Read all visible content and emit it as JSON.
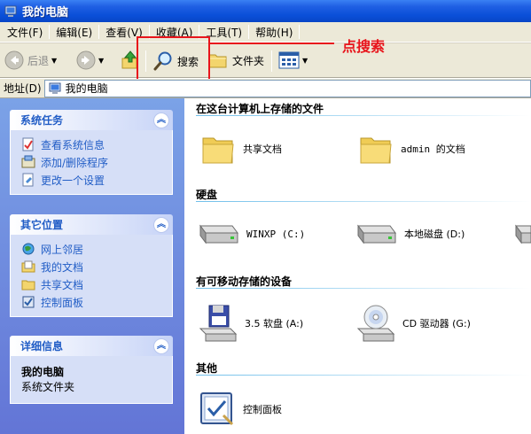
{
  "window": {
    "title": "我的电脑"
  },
  "menu": [
    "文件(F)",
    "编辑(E)",
    "查看(V)",
    "收藏(A)",
    "工具(T)",
    "帮助(H)"
  ],
  "toolbar": {
    "back": "后退",
    "search": "搜索",
    "folders": "文件夹"
  },
  "annotation": {
    "text": "点搜索"
  },
  "address": {
    "label": "地址(D)",
    "value": "我的电脑"
  },
  "panels": {
    "system_tasks": {
      "title": "系统任务",
      "items": [
        "查看系统信息",
        "添加/删除程序",
        "更改一个设置"
      ]
    },
    "other_places": {
      "title": "其它位置",
      "items": [
        "网上邻居",
        "我的文档",
        "共享文档",
        "控制面板"
      ]
    },
    "details": {
      "title": "详细信息",
      "name": "我的电脑",
      "type": "系统文件夹"
    }
  },
  "groups": {
    "stored_files": {
      "title": "在这台计算机上存储的文件",
      "items": [
        "共享文档",
        "admin 的文档"
      ]
    },
    "hard_disks": {
      "title": "硬盘",
      "items": [
        "WINXP (C:)",
        "本地磁盘 (D:)"
      ]
    },
    "removable": {
      "title": "有可移动存储的设备",
      "items": [
        "3.5 软盘 (A:)",
        "CD 驱动器 (G:)"
      ]
    },
    "other": {
      "title": "其他",
      "items": [
        "控制面板"
      ]
    }
  }
}
